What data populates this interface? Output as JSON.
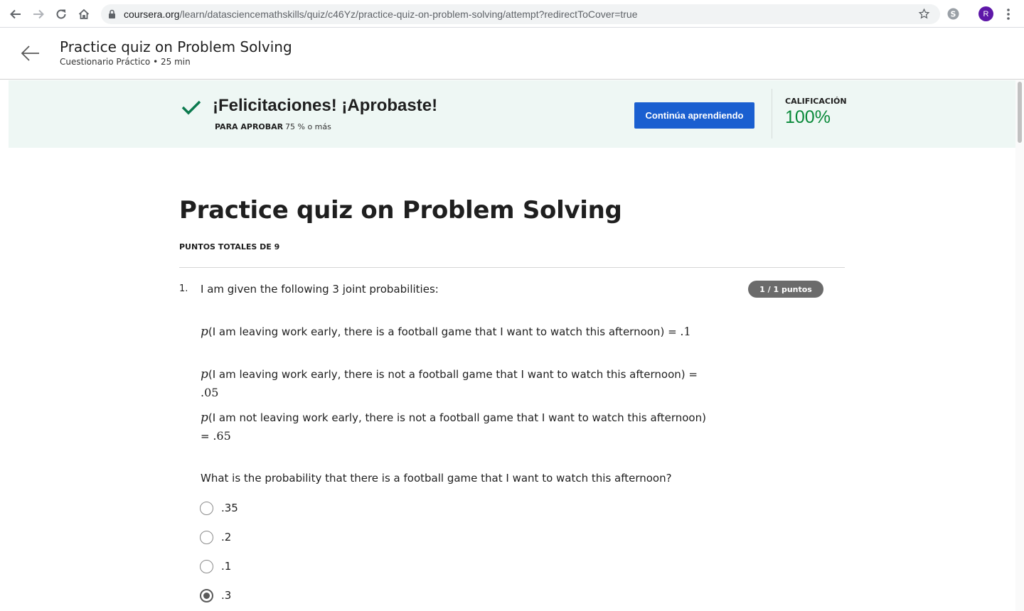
{
  "browser": {
    "url_host": "coursera.org",
    "url_path": "/learn/datasciencemathskills/quiz/c46Yz/practice-quiz-on-problem-solving/attempt?redirectToCover=true",
    "profile_initial": "R"
  },
  "header": {
    "title": "Practice quiz on Problem Solving",
    "subtitle": "Cuestionario Práctico • 25 min"
  },
  "banner": {
    "message": "¡Felicitaciones! ¡Aprobaste!",
    "pass_label": "PARA APROBAR",
    "pass_value": "75 % o más",
    "continue_label": "Continúa aprendiendo",
    "grade_label": "CALIFICACIÓN",
    "grade_value": "100%"
  },
  "main": {
    "title": "Practice quiz on Problem Solving",
    "points_total": "PUNTOS TOTALES DE 9"
  },
  "question1": {
    "number": "1.",
    "intro": "I am given the following 3 joint probabilities:",
    "score": "1 / 1 puntos",
    "probabilities": [
      {
        "p": "p",
        "text": "(I am leaving work early, there is a football game that I want to watch this afternoon) = ",
        "value": ".1"
      },
      {
        "p": "p",
        "text": "(I am leaving work early, there is not a football game that I want to watch this afternoon) = ",
        "value": ".05"
      },
      {
        "p": "p",
        "text": "(I am not leaving work early, there is not a football game that I want to watch this afternoon) = ",
        "value": ".65"
      }
    ],
    "prompt": "What is the probability that there is a football game that I want to watch this afternoon?",
    "options": [
      {
        "label": ".35",
        "selected": false
      },
      {
        "label": ".2",
        "selected": false
      },
      {
        "label": ".1",
        "selected": false
      },
      {
        "label": ".3",
        "selected": true
      }
    ]
  },
  "colors": {
    "banner_bg": "#eef7f4",
    "accent_blue": "#1a5fd0",
    "grade_green": "#0a8a3a",
    "check_green": "#0b7a4e"
  }
}
